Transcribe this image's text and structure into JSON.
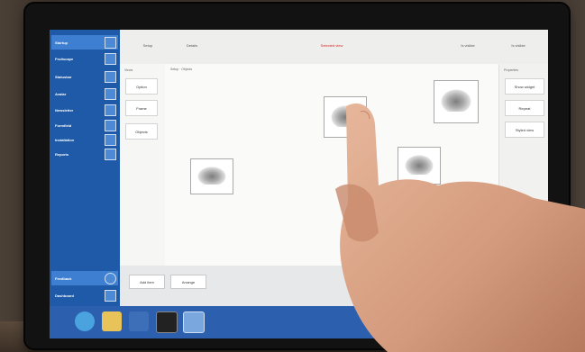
{
  "scene": {
    "description_colors": {
      "sidebar_blue": "#1e5aa8",
      "taskbar_blue": "#2c5fae",
      "accent_red": "#cc2b2b",
      "skin": "#d9a287"
    }
  },
  "sidebar": {
    "items": [
      {
        "label": "Startup",
        "icon": "window-icon"
      },
      {
        "label": "Fruitscape",
        "icon": "tool-icon"
      },
      {
        "label": "Statusbar",
        "icon": "tool-icon"
      },
      {
        "label": "Avatar",
        "icon": "doc-icon"
      },
      {
        "label": "Newsletter",
        "icon": "doc-icon"
      },
      {
        "label": "Formfield",
        "icon": "doc-icon"
      },
      {
        "label": "Installation",
        "icon": "doc-icon"
      },
      {
        "label": "Reports",
        "icon": "doc-icon"
      }
    ],
    "bottom_items": [
      {
        "label": "Feedback",
        "icon": "chat-icon"
      },
      {
        "label": "Dashboard",
        "icon": "doc-icon"
      }
    ]
  },
  "toolbar": {
    "buttons": [
      "Setup",
      "Details",
      "Selected view",
      "Is visible",
      "Is visible"
    ]
  },
  "left_panel": {
    "heading": "Views",
    "buttons": [
      "Option",
      "Frame",
      "Objects"
    ]
  },
  "canvas": {
    "breadcrumb": "Setup · Objects"
  },
  "right_panel": {
    "heading": "Properties",
    "buttons": [
      "Show widget",
      "Repeat",
      "Styled view"
    ]
  },
  "bottom_bar": {
    "buttons": [
      "Add item",
      "Arrange"
    ]
  }
}
